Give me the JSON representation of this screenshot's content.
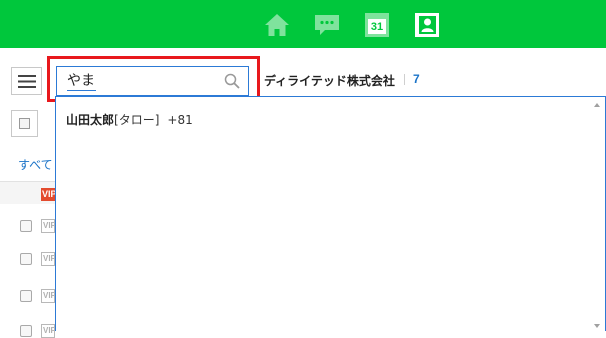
{
  "nav": {
    "icons": [
      "home-icon",
      "chat-icon",
      "calendar-icon",
      "contacts-icon"
    ],
    "calendar_day": "31",
    "accent_color": "#00c73c"
  },
  "search": {
    "query": "やま"
  },
  "company": {
    "name": "ディライテッド株式会社",
    "count": "7"
  },
  "filter": {
    "all_label": "すべて"
  },
  "badges": {
    "vip": "VIP"
  },
  "suggestions": [
    {
      "name": "山田太郎",
      "alias": "[タロー]",
      "extension": "+81"
    }
  ]
}
